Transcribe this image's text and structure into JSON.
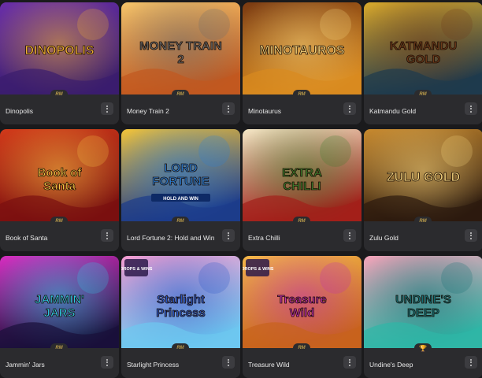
{
  "provider_badge_text": "RM",
  "games": [
    {
      "title": "Dinopolis",
      "art_text": "DINOPOLIS",
      "colors": [
        "#3a1d6e",
        "#6a2fa8",
        "#f2b134"
      ]
    },
    {
      "title": "Money Train 2",
      "art_text": "MONEY TRAIN 2",
      "colors": [
        "#c2581f",
        "#f4c36a",
        "#6b6b6b"
      ]
    },
    {
      "title": "Minotaurus",
      "art_text": "MINOTAUROS",
      "colors": [
        "#d98a1f",
        "#7a3a12",
        "#f5d27a"
      ]
    },
    {
      "title": "Katmandu Gold",
      "art_text": "KATMANDU GOLD",
      "colors": [
        "#1e3a4d",
        "#d9a82b",
        "#6e3b1a"
      ]
    },
    {
      "title": "Book of Santa",
      "art_text": "Book of Santa",
      "colors": [
        "#7a0f0f",
        "#d13a1a",
        "#f7c443"
      ]
    },
    {
      "title": "Lord Fortune 2: Hold and Win",
      "art_text": "LORD FORTUNE",
      "subtitle": "HOLD AND WIN",
      "colors": [
        "#1d3c8a",
        "#f1c33b",
        "#2a7ed6"
      ]
    },
    {
      "title": "Extra Chilli",
      "art_text": "EXTRA CHILLI",
      "colors": [
        "#a3201a",
        "#f2e6c4",
        "#3d7a2b"
      ]
    },
    {
      "title": "Zulu Gold",
      "art_text": "ZULU GOLD",
      "colors": [
        "#2c1a0e",
        "#c88a2f",
        "#f4d27c"
      ]
    },
    {
      "title": "Jammin' Jars",
      "art_text": "JAMMIN' JARS",
      "colors": [
        "#1a0f3a",
        "#d62fc1",
        "#2fc9e8"
      ]
    },
    {
      "title": "Starlight Princess",
      "art_text": "Starlight Princess",
      "badge": "DROPS & WINS",
      "colors": [
        "#6dc7f0",
        "#f29bd0",
        "#2a58c9"
      ]
    },
    {
      "title": "Treasure Wild",
      "art_text": "Treasure Wild",
      "badge": "DROPS & WINS",
      "colors": [
        "#c8631d",
        "#f3b64a",
        "#c02fb0"
      ]
    },
    {
      "title": "Undine's Deep",
      "art_text": "UNDINE'S DEEP",
      "colors": [
        "#2fb6a6",
        "#f3a2b8",
        "#136e73"
      ]
    }
  ],
  "icons": {
    "more": "more-vertical-icon",
    "provider": "provider-logo-icon",
    "trophy": "trophy-icon"
  }
}
